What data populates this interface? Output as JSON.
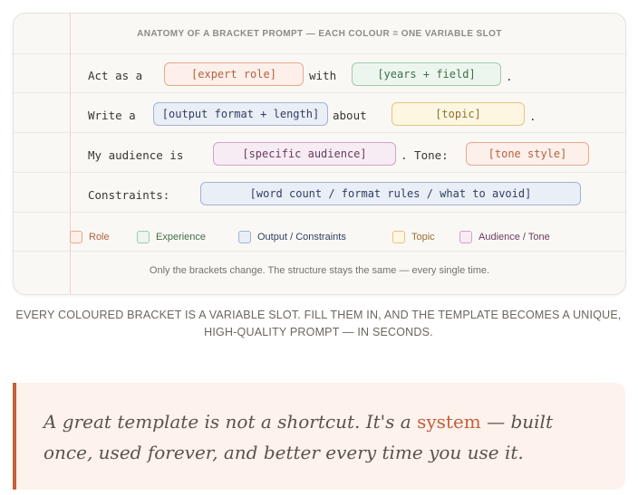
{
  "card": {
    "heading": "ANATOMY OF A BRACKET PROMPT — EACH COLOUR = ONE VARIABLE SLOT",
    "rows": [
      {
        "prefix": "Act as a",
        "slot1": "[expert role]",
        "mid": "with",
        "slot2": "[years + field]",
        "end": "."
      },
      {
        "prefix": "Write a",
        "slot1": "[output format + length]",
        "mid": "about",
        "slot2": "[topic]",
        "end": "."
      },
      {
        "prefix": "My audience is",
        "slot1": "[specific audience]",
        "mid": ". Tone:",
        "slot2": "[tone style]"
      },
      {
        "prefix": "Constraints:",
        "slot1": "[word count / format rules / what to avoid]"
      }
    ],
    "legend": [
      "Role",
      "Experience",
      "Output / Constraints",
      "Topic",
      "Audience / Tone"
    ],
    "footnote": "Only the brackets change. The structure stays the same — every single time."
  },
  "caption": "EVERY COLOURED BRACKET IS A VARIABLE SLOT. FILL THEM IN, AND THE TEMPLATE BECOMES A UNIQUE, HIGH-QUALITY PROMPT — IN SECONDS.",
  "quote": {
    "before": "A great template is not a shortcut. It's a ",
    "highlight": "system",
    "after": " — built once, used forever, and better every time you use it."
  },
  "colors": {
    "role": "#e7a88f",
    "experience": "#9fcca8",
    "output": "#a3b2d2",
    "topic": "#e5c57c",
    "audience": "#d2a4c7",
    "accent": "#c4603c"
  }
}
